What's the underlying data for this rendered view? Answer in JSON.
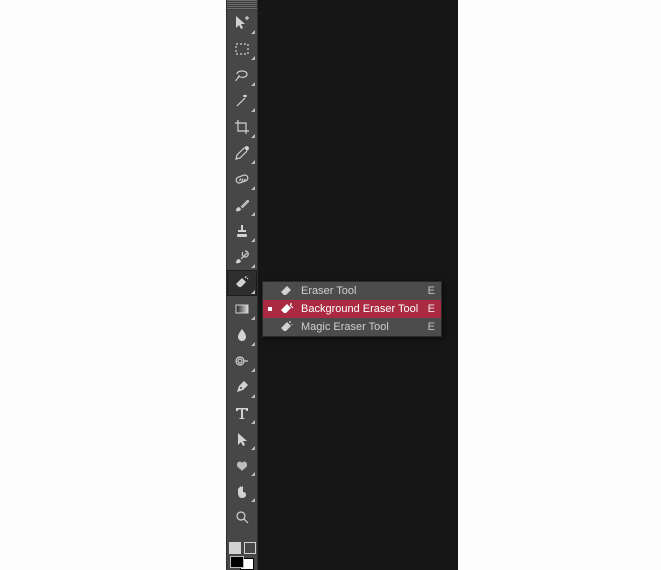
{
  "toolbar": {
    "tools": [
      {
        "name": "move-tool"
      },
      {
        "name": "rectangular-marquee-tool"
      },
      {
        "name": "lasso-tool"
      },
      {
        "name": "magic-wand-tool"
      },
      {
        "name": "crop-tool"
      },
      {
        "name": "eyedropper-tool"
      },
      {
        "name": "spot-healing-brush-tool"
      },
      {
        "name": "brush-tool"
      },
      {
        "name": "clone-stamp-tool"
      },
      {
        "name": "history-brush-tool"
      },
      {
        "name": "eraser-tool",
        "active": true
      },
      {
        "name": "gradient-tool"
      },
      {
        "name": "blur-tool"
      },
      {
        "name": "dodge-tool"
      },
      {
        "name": "pen-tool"
      },
      {
        "name": "type-tool"
      },
      {
        "name": "path-selection-tool"
      },
      {
        "name": "custom-shape-tool"
      },
      {
        "name": "hand-tool"
      },
      {
        "name": "zoom-tool"
      }
    ]
  },
  "flyout": {
    "items": [
      {
        "label": "Eraser Tool",
        "shortcut": "E",
        "icon": "eraser-icon",
        "selected": false
      },
      {
        "label": "Background Eraser Tool",
        "shortcut": "E",
        "icon": "background-eraser-icon",
        "selected": true
      },
      {
        "label": "Magic Eraser Tool",
        "shortcut": "E",
        "icon": "magic-eraser-icon",
        "selected": false
      }
    ]
  }
}
